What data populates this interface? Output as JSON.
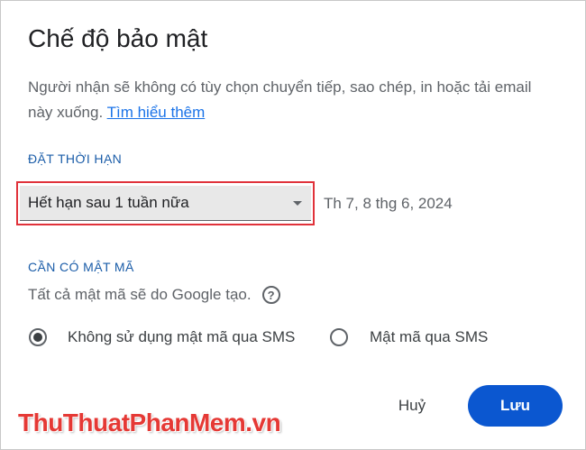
{
  "dialog": {
    "title": "Chế độ bảo mật",
    "description": "Người nhận sẽ không có tùy chọn chuyển tiếp, sao chép, in hoặc tải email này xuống.",
    "learn_more": "Tìm hiểu thêm"
  },
  "expiry": {
    "section_label": "ĐẶT THỜI HẠN",
    "selected_option": "Hết hạn sau 1 tuần nữa",
    "date": "Th 7, 8 thg 6, 2024"
  },
  "passcode": {
    "section_label": "CẦN CÓ MẬT MÃ",
    "hint": "Tất cả mật mã sẽ do Google tạo.",
    "option_no_sms": "Không sử dụng mật mã qua SMS",
    "option_sms": "Mật mã qua SMS",
    "selected": "option_no_sms"
  },
  "actions": {
    "cancel_label": "Huỷ",
    "save_label": "Lưu"
  },
  "watermark": "ThuThuatPhanMem.vn",
  "colors": {
    "accent": "#0b57d0",
    "section_label": "#1a5ca8",
    "highlight_border": "#e0323a"
  }
}
